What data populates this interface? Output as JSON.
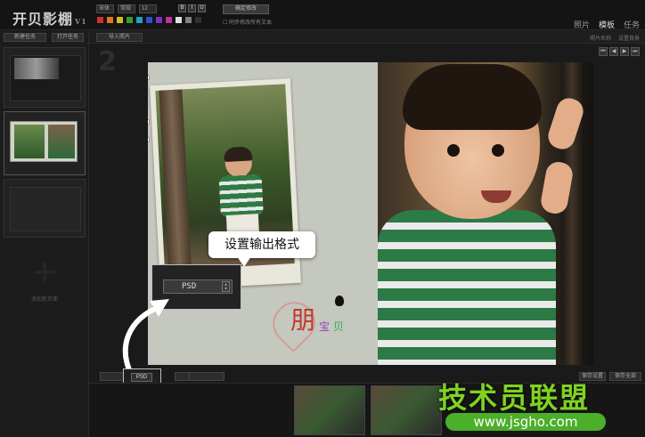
{
  "app": {
    "title": "开贝影棚",
    "version": "V1"
  },
  "toolbar": {
    "font_family": "宋体",
    "font_style": "常规",
    "font_size": "12",
    "format_bold": "B",
    "format_italic": "I",
    "format_underline": "U",
    "apply_button": "确定修改",
    "checkbox_label": "同步修改所有文本",
    "swatch_colors": [
      "#d03030",
      "#e07a20",
      "#d0c020",
      "#30a030",
      "#20a0c0",
      "#3050d0",
      "#8030c0",
      "#c030a0",
      "#e0e0e0",
      "#808080",
      "#303030"
    ]
  },
  "topnav": {
    "items": [
      {
        "label": "照片"
      },
      {
        "label": "模板"
      },
      {
        "label": "任务"
      }
    ],
    "active": 1
  },
  "leftpanel": {
    "new_button": "新建任务",
    "open_button": "打开任务",
    "add_label": "添加新页面"
  },
  "toolbar2": {
    "import_button": "导入照片",
    "right_items": [
      "照片名称",
      "设置背景"
    ]
  },
  "page": {
    "number": "2"
  },
  "callout": {
    "text": "设置输出格式"
  },
  "output_format": {
    "value": "PSD"
  },
  "small_format": {
    "value": "PSD"
  },
  "bottombar": {
    "right_buttons": [
      "保存设置",
      "保存全部"
    ]
  },
  "watermark": {
    "title": "技术员联盟",
    "url": "www.jsgho.com"
  },
  "design": {
    "logo_title": "朋",
    "logo_sub1": "宝",
    "logo_sub2": "贝"
  }
}
